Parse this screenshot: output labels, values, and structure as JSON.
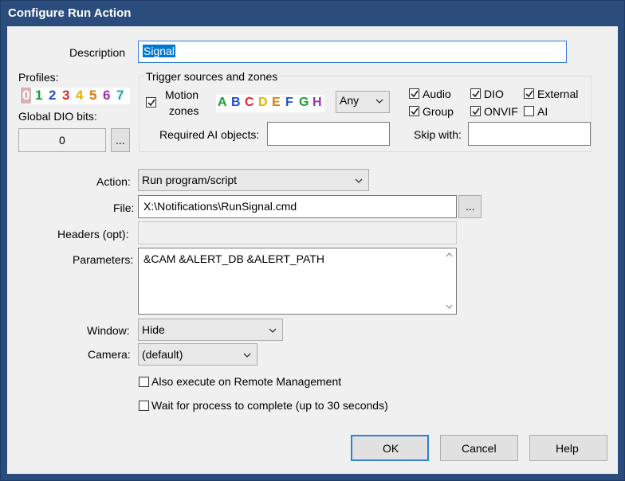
{
  "window": {
    "title": "Configure Run Action"
  },
  "description": {
    "label": "Description",
    "value": "Signal"
  },
  "profiles": {
    "label": "Profiles:",
    "items": [
      {
        "text": "0",
        "color": "#c98a8a"
      },
      {
        "text": "1",
        "color": "#1a9e2d"
      },
      {
        "text": "2",
        "color": "#1f4ed8"
      },
      {
        "text": "3",
        "color": "#d62828"
      },
      {
        "text": "4",
        "color": "#e1b600"
      },
      {
        "text": "5",
        "color": "#e07a10"
      },
      {
        "text": "6",
        "color": "#9a2fb0"
      },
      {
        "text": "7",
        "color": "#10a8a8"
      }
    ]
  },
  "global_dio": {
    "label": "Global DIO bits:",
    "value": "0",
    "button": "..."
  },
  "trigger": {
    "group_label": "Trigger sources and zones",
    "motion_zones_label_line1": "Motion",
    "motion_zones_label_line2": "zones",
    "motion_zones_checked": true,
    "zones": [
      {
        "text": "A",
        "color": "#1a9e2d"
      },
      {
        "text": "B",
        "color": "#1f4ed8"
      },
      {
        "text": "C",
        "color": "#d62828"
      },
      {
        "text": "D",
        "color": "#e1b600"
      },
      {
        "text": "E",
        "color": "#e07a10"
      },
      {
        "text": "F",
        "color": "#1f4ed8"
      },
      {
        "text": "G",
        "color": "#1a9e2d"
      },
      {
        "text": "H",
        "color": "#9a2fb0"
      }
    ],
    "any_select": "Any",
    "checks": {
      "audio": {
        "label": "Audio",
        "checked": true
      },
      "dio": {
        "label": "DIO",
        "checked": true
      },
      "external": {
        "label": "External",
        "checked": true
      },
      "group": {
        "label": "Group",
        "checked": true
      },
      "onvif": {
        "label": "ONVIF",
        "checked": true
      },
      "ai": {
        "label": "AI",
        "checked": false
      }
    },
    "required_ai_label": "Required AI objects:",
    "required_ai_value": "",
    "skip_with_label": "Skip with:",
    "skip_with_value": ""
  },
  "action": {
    "label": "Action:",
    "value": "Run program/script"
  },
  "file": {
    "label": "File:",
    "value": "X:\\Notifications\\RunSignal.cmd",
    "button": "..."
  },
  "headers": {
    "label": "Headers (opt):",
    "value": ""
  },
  "parameters": {
    "label": "Parameters:",
    "value": "&CAM &ALERT_DB &ALERT_PATH"
  },
  "window_mode": {
    "label": "Window:",
    "value": "Hide"
  },
  "camera": {
    "label": "Camera:",
    "value": "(default)"
  },
  "options": {
    "remote_mgmt": {
      "label": "Also execute on Remote Management",
      "checked": false
    },
    "wait_process": {
      "label": "Wait for process to complete (up to 30 seconds)",
      "checked": false
    }
  },
  "buttons": {
    "ok": "OK",
    "cancel": "Cancel",
    "help": "Help"
  }
}
